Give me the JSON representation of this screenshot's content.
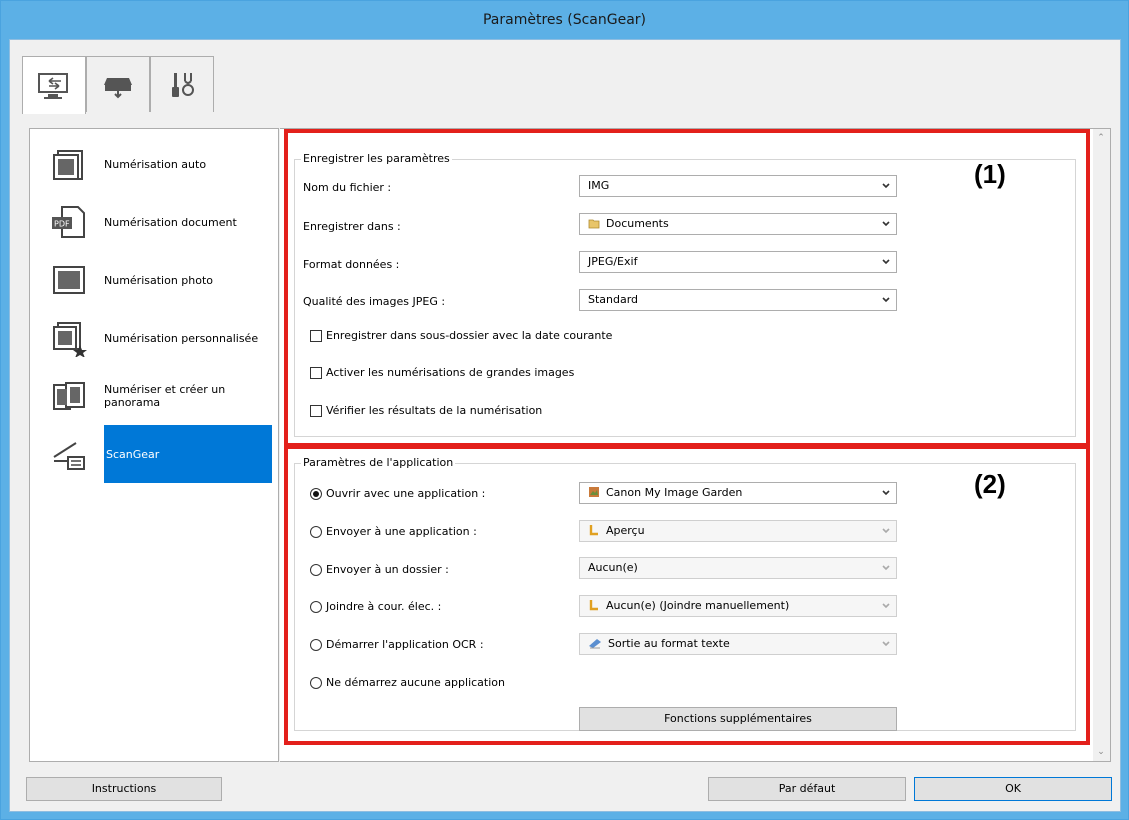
{
  "window": {
    "title": "Paramètres (ScanGear)"
  },
  "tabs": [
    {
      "name": "scan-from-computer-icon"
    },
    {
      "name": "scan-from-operation-panel-icon"
    },
    {
      "name": "general-settings-icon"
    }
  ],
  "sidebar": {
    "items": [
      {
        "label": "Numérisation auto",
        "icon": "auto-scan-icon"
      },
      {
        "label": "Numérisation document",
        "icon": "document-scan-icon"
      },
      {
        "label": "Numérisation photo",
        "icon": "photo-scan-icon"
      },
      {
        "label": "Numérisation personnalisée",
        "icon": "custom-scan-icon"
      },
      {
        "label": "Numériser et créer un panorama",
        "icon": "panorama-icon"
      },
      {
        "label": "ScanGear",
        "icon": "scangear-icon",
        "selected": true
      }
    ]
  },
  "save_settings": {
    "title": "Enregistrer les paramètres",
    "marker": "(1)",
    "file_name_label": "Nom du fichier :",
    "file_name_value": "IMG",
    "save_in_label": "Enregistrer dans :",
    "save_in_value": "Documents",
    "data_format_label": "Format données :",
    "data_format_value": "JPEG/Exif",
    "jpeg_quality_label": "Qualité des images JPEG :",
    "jpeg_quality_value": "Standard",
    "subfolder_label": "Enregistrer dans sous-dossier avec la date courante",
    "large_scans_label": "Activer les numérisations de grandes images",
    "check_results_label": "Vérifier les résultats de la numérisation"
  },
  "app_settings": {
    "title": "Paramètres de l'application",
    "marker": "(2)",
    "open_with_label": "Ouvrir avec une application :",
    "open_with_value": "Canon My Image Garden",
    "send_to_app_label": "Envoyer à une application :",
    "send_to_app_value": "Aperçu",
    "send_to_folder_label": "Envoyer à un dossier :",
    "send_to_folder_value": "Aucun(e)",
    "attach_email_label": "Joindre à cour. élec. :",
    "attach_email_value": "Aucun(e) (Joindre manuellement)",
    "ocr_label": "Démarrer l'application OCR :",
    "ocr_value": "Sortie au format texte",
    "no_app_label": "Ne démarrez aucune application",
    "more_functions_label": "Fonctions supplémentaires"
  },
  "footer": {
    "instructions_label": "Instructions",
    "defaults_label": "Par défaut",
    "ok_label": "OK"
  },
  "colors": {
    "titlebar": "#5cb0e6",
    "highlight": "#e3201b",
    "selection": "#0078d7"
  }
}
